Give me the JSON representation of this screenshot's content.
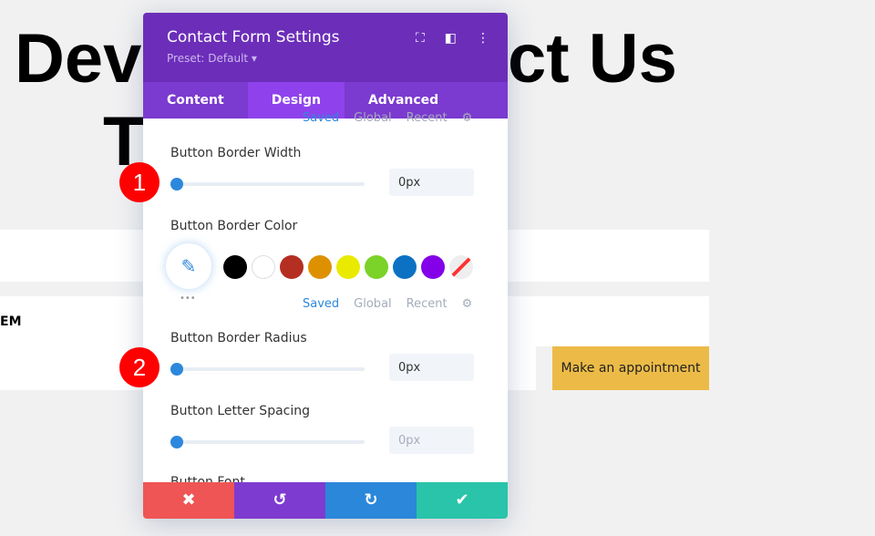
{
  "background": {
    "heading_left": "Dev",
    "heading_right": "ct Us",
    "heading_line2": "T",
    "row_text": "EM",
    "cta_button": "Make an appointment"
  },
  "panel": {
    "title": "Contact Form Settings",
    "preset": "Preset: Default ▾",
    "tabs": [
      {
        "label": "Content"
      },
      {
        "label": "Design"
      },
      {
        "label": "Advanced"
      }
    ],
    "palette_tabs": {
      "saved": "Saved",
      "global": "Global",
      "recent": "Recent"
    },
    "fields": {
      "border_width": {
        "label": "Button Border Width",
        "value": "0px"
      },
      "border_color": {
        "label": "Button Border Color",
        "swatches": [
          "#000000",
          "#ffffff",
          "#b42e22",
          "#dd9100",
          "#eaea00",
          "#7bd228",
          "#0c71c3",
          "#8300e9"
        ]
      },
      "border_radius": {
        "label": "Button Border Radius",
        "value": "0px"
      },
      "letter_spacing": {
        "label": "Button Letter Spacing",
        "value": "0px"
      },
      "font": {
        "label": "Button Font"
      }
    },
    "more": "•••"
  },
  "badges": [
    "1",
    "2"
  ],
  "colors": {
    "header": "#6c2eb9",
    "tab_active": "#8f42ec",
    "cancel": "#ef5555",
    "undo": "#7e3bd0",
    "redo": "#2b87da",
    "save": "#29c4a9",
    "cta": "#ecbb47"
  }
}
